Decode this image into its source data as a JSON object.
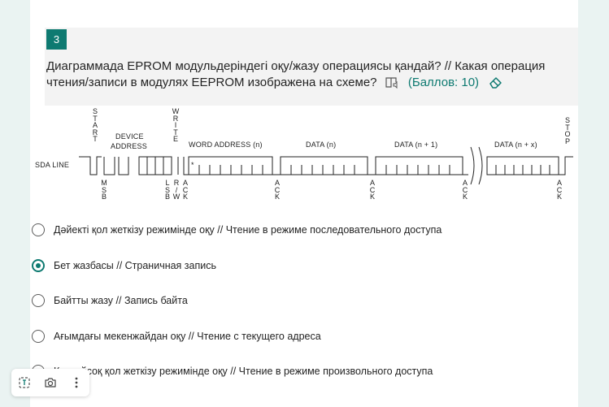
{
  "question": {
    "number": "3",
    "text": "Диаграммада EPROM модульдеріндегі оқу/жазу операциясы қандай? // Какая операция чтения/записи в модулях EEPROM изображена на схеме?",
    "points": "(Баллов: 10)"
  },
  "diagram": {
    "sda_line": "SDA LINE",
    "start": [
      "S",
      "T",
      "A",
      "R",
      "T"
    ],
    "device_address": [
      "DEVICE",
      "ADDRESS"
    ],
    "write": [
      "W",
      "R",
      "I",
      "T",
      "E"
    ],
    "word_address": "WORD ADDRESS (n)",
    "data_n": "DATA (n)",
    "data_n1": "DATA (n + 1)",
    "data_nx": "DATA (n + x)",
    "stop": [
      "S",
      "T",
      "O",
      "P"
    ],
    "msb": [
      "M",
      "S",
      "B"
    ],
    "lsb": [
      "L",
      "S",
      "B"
    ],
    "rw": [
      "R",
      "/",
      "W"
    ],
    "ack": [
      "A",
      "C",
      "K"
    ],
    "star": "*"
  },
  "options": [
    {
      "label": "Дәйекті қол жеткізу режимінде оқу // Чтение в режиме последовательного доступа",
      "selected": false
    },
    {
      "label": "Бет жазбасы // Страничная запись",
      "selected": true
    },
    {
      "label": "Байтты жазу // Запись байта",
      "selected": false
    },
    {
      "label": "Ағымдағы мекенжайдан оқу // Чтение с текущего адреса",
      "selected": false
    },
    {
      "label": "Кездейсоқ қол жеткізу режимінде оқу // Чтение в режиме произвольного доступа",
      "selected": false
    }
  ],
  "toolbar": {
    "icons": [
      "immersive-reader-icon",
      "camera-icon",
      "more-icon"
    ]
  },
  "colors": {
    "accent": "#0e7a71",
    "background": "#eaf3f2"
  }
}
